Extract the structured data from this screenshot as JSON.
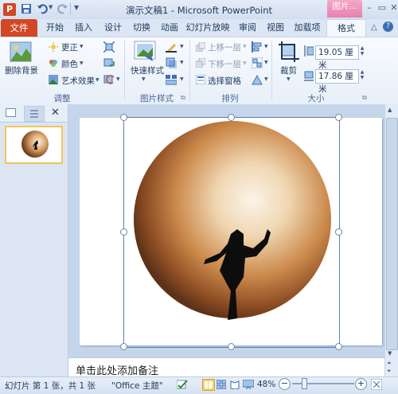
{
  "window": {
    "title": "演示文稿1 - Microsoft PowerPoint",
    "context_tab_label": "图片..."
  },
  "ribbon_tabs": {
    "file": "文件",
    "items": [
      "开始",
      "插入",
      "设计",
      "切换",
      "动画",
      "幻灯片放映",
      "审阅",
      "视图",
      "加载项"
    ],
    "active": "格式"
  },
  "adjust": {
    "remove_bg": "删除背景",
    "corrections": "更正",
    "color": "颜色",
    "artistic": "艺术效果",
    "label": "调整"
  },
  "picture_styles": {
    "quick_styles": "快速样式",
    "label": "图片样式"
  },
  "arrange": {
    "bring_forward": "上移一层",
    "send_backward": "下移一层",
    "selection_pane": "选择窗格",
    "label": "排列"
  },
  "size": {
    "crop": "裁剪",
    "height": "19.05 厘米",
    "width": "17.86 厘米",
    "label": "大小"
  },
  "slide_pane": {
    "slide_number": "1"
  },
  "notes": {
    "placeholder": "单击此处添加备注"
  },
  "status": {
    "slide_info": "幻灯片 第 1 张，共 1 张",
    "theme": "\"Office 主题\"",
    "zoom": "48%"
  },
  "colors": {
    "file_tab": "#d24726",
    "context_tab": "#e97fb0",
    "ribbon_bg": "#f8fbff",
    "selection_border": "#5a7fb0"
  }
}
